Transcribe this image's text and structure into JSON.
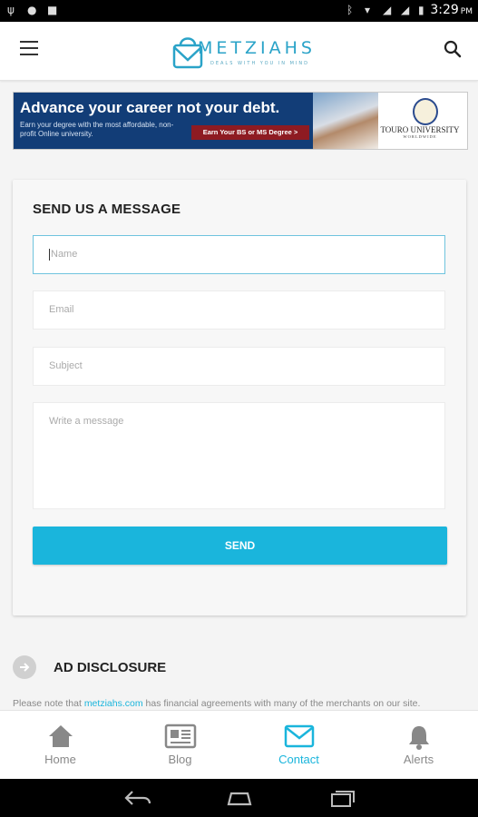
{
  "status_bar": {
    "time": "3:29",
    "ampm": "PM"
  },
  "header": {
    "brand": "METZIAHS",
    "tagline": "DEALS WITH YOU IN MIND"
  },
  "ad": {
    "headline": "Advance your career not your debt.",
    "subtext": "Earn your degree with the most affordable, non-profit Online university.",
    "cta": "Earn Your BS or MS Degree >",
    "university": "TOURO UNIVERSITY",
    "university_sub": "WORLDWIDE"
  },
  "contact_form": {
    "title": "SEND US A MESSAGE",
    "name_placeholder": "Name",
    "email_placeholder": "Email",
    "subject_placeholder": "Subject",
    "message_placeholder": "Write a message",
    "send_label": "SEND"
  },
  "disclosure": {
    "title": "AD DISCLOSURE",
    "text_before": "Please note that ",
    "link": "metziahs.com",
    "text_after": " has financial agreements with many of the merchants on our site."
  },
  "bottom_nav": {
    "items": [
      {
        "label": "Home",
        "icon": "home-icon"
      },
      {
        "label": "Blog",
        "icon": "newspaper-icon"
      },
      {
        "label": "Contact",
        "icon": "mail-icon",
        "active": true
      },
      {
        "label": "Alerts",
        "icon": "bell-icon"
      }
    ]
  },
  "colors": {
    "accent": "#1ab5dc",
    "brand": "#2aa3c8",
    "ad_blue": "#123d77",
    "ad_cta": "#8e1b22"
  }
}
